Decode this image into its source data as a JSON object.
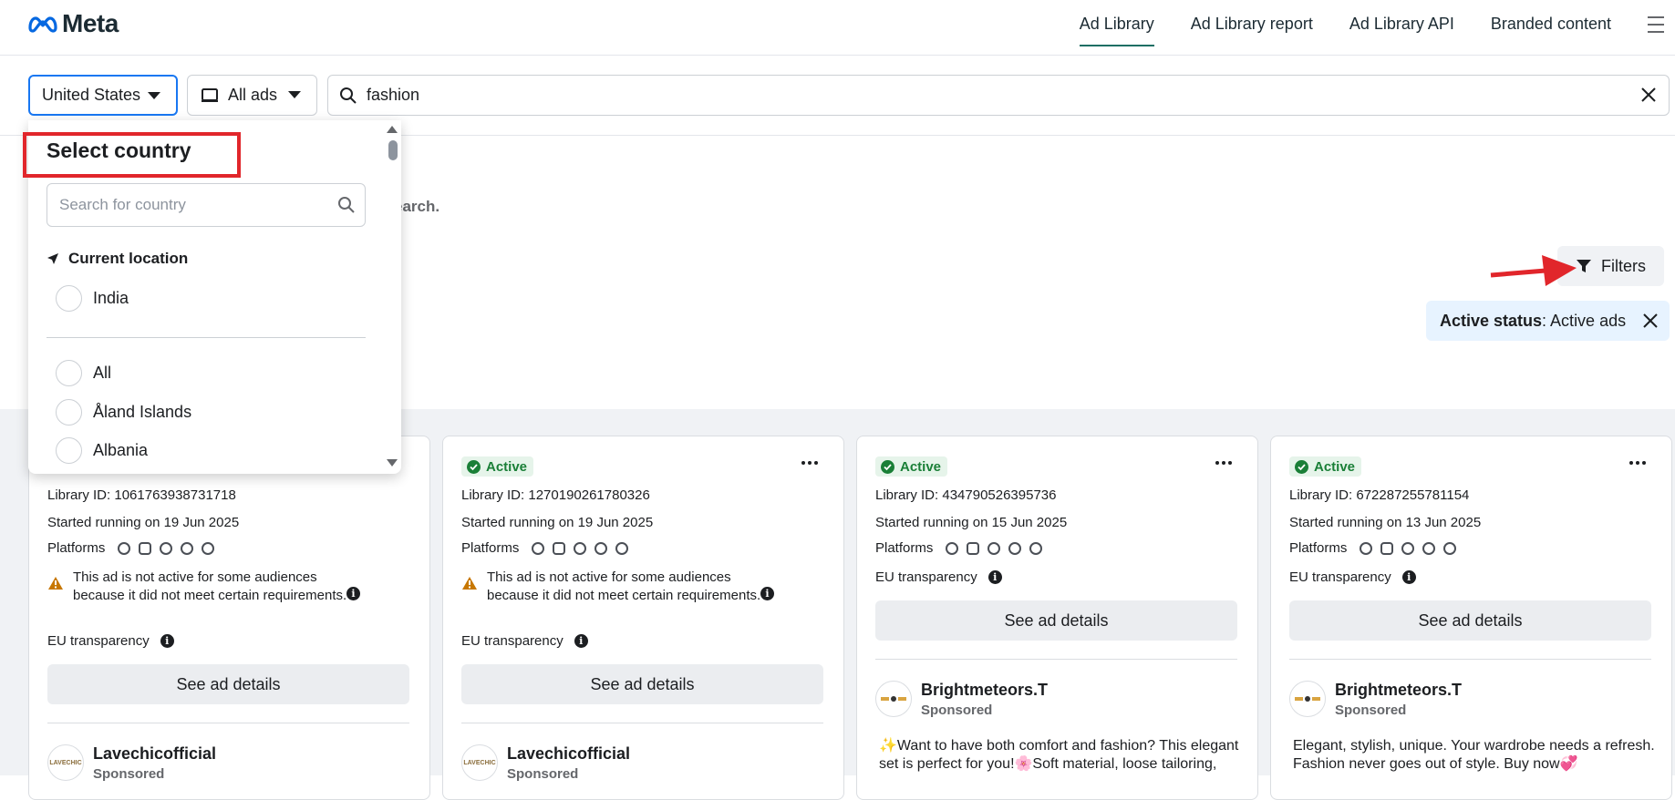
{
  "header": {
    "logo_text": "Meta",
    "nav": [
      {
        "label": "Ad Library",
        "active": true
      },
      {
        "label": "Ad Library report",
        "active": false
      },
      {
        "label": "Ad Library API",
        "active": false
      },
      {
        "label": "Branded content",
        "active": false
      }
    ]
  },
  "search": {
    "country": "United States",
    "ad_type": "All ads",
    "query": "fashion"
  },
  "page": {
    "hint_fragment": "earch.",
    "filters_label": "Filters",
    "active_status_key": "Active status",
    "active_status_value": ": Active ads"
  },
  "dropdown": {
    "title": "Select country",
    "search_placeholder": "Search for country",
    "current_location_label": "Current location",
    "current_location": "India",
    "options": [
      "All",
      "Åland Islands",
      "Albania"
    ]
  },
  "cards": [
    {
      "status": "",
      "library_id": "Library ID: 1061763938731718",
      "started": "Started running on 19 Jun 2025",
      "platforms_label": "Platforms",
      "warning": "This ad is not active for some audiences because it did not meet certain requirements.",
      "eu": "EU transparency",
      "see_details": "See ad details",
      "advertiser": "Lavechicofficial",
      "sponsored": "Sponsored",
      "avatar_text": "LAVECHIC",
      "body": ""
    },
    {
      "status": "Active",
      "library_id": "Library ID: 1270190261780326",
      "started": "Started running on 19 Jun 2025",
      "platforms_label": "Platforms",
      "warning": "This ad is not active for some audiences because it did not meet certain requirements.",
      "eu": "EU transparency",
      "see_details": "See ad details",
      "advertiser": "Lavechicofficial",
      "sponsored": "Sponsored",
      "avatar_text": "LAVECHIC",
      "body": ""
    },
    {
      "status": "Active",
      "library_id": "Library ID: 434790526395736",
      "started": "Started running on 15 Jun 2025",
      "platforms_label": "Platforms",
      "warning": "",
      "eu": "EU transparency",
      "see_details": "See ad details",
      "advertiser": "Brightmeteors.T",
      "sponsored": "Sponsored",
      "avatar_text": "",
      "body": "✨Want to have both comfort and fashion? This elegant set is perfect for you!🌸Soft material, loose tailoring,"
    },
    {
      "status": "Active",
      "library_id": "Library ID: 672287255781154",
      "started": "Started running on 13 Jun 2025",
      "platforms_label": "Platforms",
      "warning": "",
      "eu": "EU transparency",
      "see_details": "See ad details",
      "advertiser": "Brightmeteors.T",
      "sponsored": "Sponsored",
      "avatar_text": "",
      "body": "Elegant, stylish, unique. Your wardrobe needs a refresh. Fashion never goes out of style. Buy now💞"
    }
  ],
  "colors": {
    "accent": "#1877f2",
    "annotation_red": "#e1262b",
    "active_green": "#1a7f37",
    "chip_blue": "#e7f3ff"
  }
}
